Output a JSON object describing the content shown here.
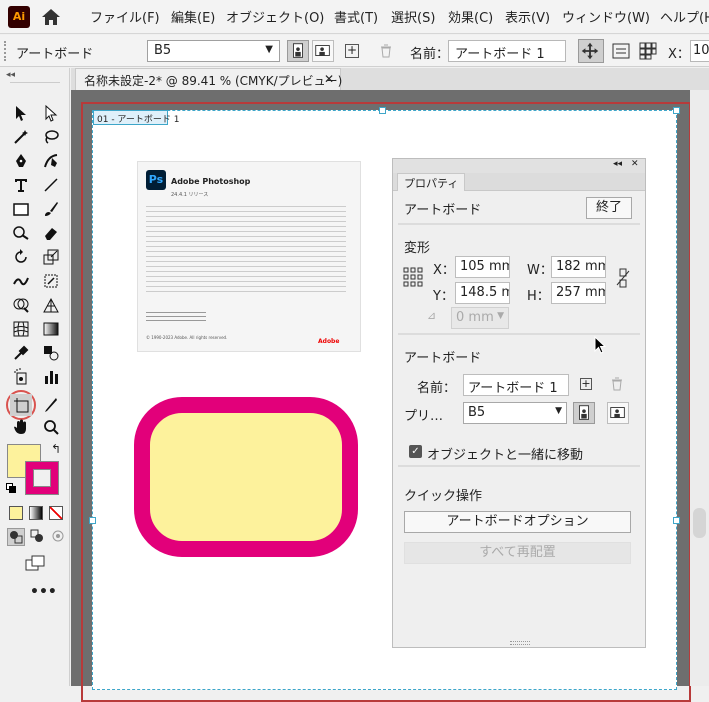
{
  "app": {
    "logo": "Ai"
  },
  "menu": {
    "items": [
      "ファイル(F)",
      "編集(E)",
      "オブジェクト(O)",
      "書式(T)",
      "選択(S)",
      "効果(C)",
      "表示(V)",
      "ウィンドウ(W)",
      "ヘルプ(H"
    ]
  },
  "control_bar": {
    "label": "アートボード",
    "preset": "B5",
    "name_label": "名前：",
    "name_value": "アートボード 1",
    "x_label": "X：",
    "x_value": "10"
  },
  "document": {
    "tab_title": "名称未設定-2* @ 89.41 % (CMYK/プレビュー)",
    "artboard_label": "01 - アートボード 1"
  },
  "splash": {
    "product": "Adobe Photoshop",
    "version": "24.4.1 リリース",
    "brand": "Adobe",
    "copyright": "© 1990-2023 Adobe. All rights reserved."
  },
  "properties": {
    "tab": "プロパティ",
    "section_artboard": "アートボード",
    "exit_button": "終了",
    "transform_title": "変形",
    "x_label": "X：",
    "x_value": "105 mm",
    "y_label": "Y：",
    "y_value": "148.5 m",
    "w_label": "W：",
    "w_value": "182 mm",
    "h_label": "H：",
    "h_value": "257 mm",
    "angle_value": "0 mm",
    "artboard_title": "アートボード",
    "name_label": "名前：",
    "name_value": "アートボード 1",
    "preset_label": "プリ…",
    "preset_value": "B5",
    "move_with_artboard": "オブジェクトと一緒に移動",
    "quick_actions_title": "クイック操作",
    "artboard_options_button": "アートボードオプション",
    "rearrange_all_button": "すべて再配置"
  },
  "colors": {
    "fill": "#fdf29c",
    "stroke": "#e2007a",
    "accent_highlight": "#d9534f"
  }
}
